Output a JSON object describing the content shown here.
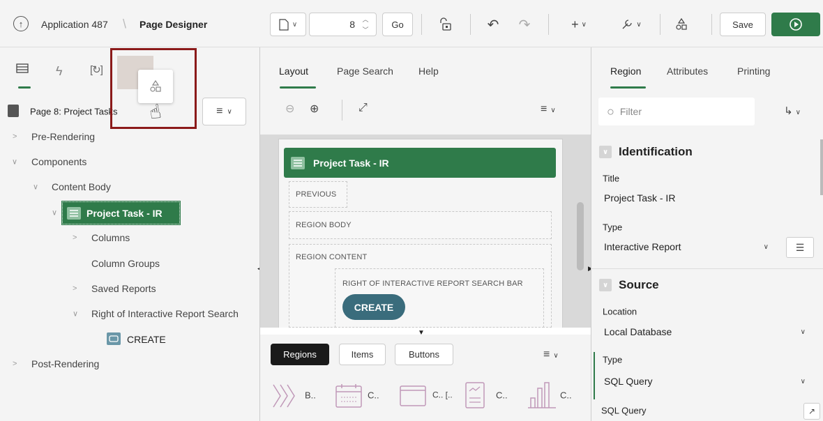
{
  "header": {
    "app_name": "Application 487",
    "separator": "\\",
    "page_designer": "Page Designer",
    "page_number": "8",
    "go_label": "Go",
    "save_label": "Save"
  },
  "left_panel": {
    "page_title": "Page 8: Project Tasks",
    "tree": {
      "pre_rendering": "Pre-Rendering",
      "components": "Components",
      "content_body": "Content Body",
      "region": "Project Task - IR",
      "columns": "Columns",
      "column_groups": "Column Groups",
      "saved_reports": "Saved Reports",
      "right_of_search": "Right of Interactive Report Search",
      "create_button": "CREATE",
      "post_rendering": "Post-Rendering"
    }
  },
  "center_panel": {
    "tabs": [
      "Layout",
      "Page Search",
      "Help"
    ],
    "region_title": "Project Task - IR",
    "slots": {
      "previous": "PREVIOUS",
      "region_body": "REGION BODY",
      "region_content": "REGION CONTENT",
      "right_of_search_bar": "RIGHT OF INTERACTIVE REPORT SEARCH BAR"
    },
    "create_button": "CREATE",
    "gallery_tabs": [
      "Regions",
      "Items",
      "Buttons"
    ],
    "gallery_items": [
      "B..",
      "C..",
      "C.. [..",
      "C..",
      "C.."
    ]
  },
  "right_panel": {
    "tabs": [
      "Region",
      "Attributes",
      "Printing"
    ],
    "filter_placeholder": "Filter",
    "identification": {
      "header": "Identification",
      "title_label": "Title",
      "title_value": "Project Task - IR",
      "type_label": "Type",
      "type_value": "Interactive Report"
    },
    "source": {
      "header": "Source",
      "location_label": "Location",
      "location_value": "Local Database",
      "type_label": "Type",
      "type_value": "SQL Query",
      "sql_query_label": "SQL Query"
    }
  },
  "colors": {
    "accent": "#2f7b4a",
    "highlight_border": "#8b1a1a",
    "create_button": "#3a6c7c"
  }
}
